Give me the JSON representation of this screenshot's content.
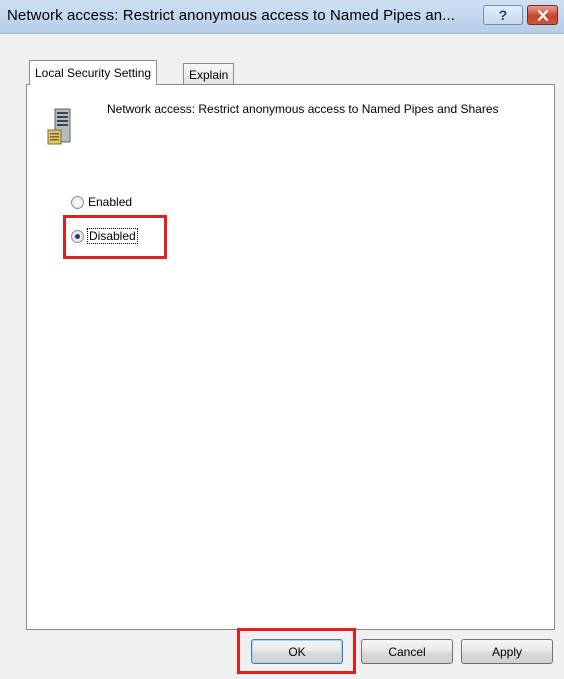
{
  "window": {
    "title": "Network access: Restrict anonymous access to Named Pipes an...",
    "help_glyph": "?"
  },
  "tabs": [
    {
      "label": "Local Security Setting",
      "active": true
    },
    {
      "label": "Explain",
      "active": false
    }
  ],
  "policy": {
    "icon": "server-icon",
    "description": "Network access: Restrict anonymous access to Named Pipes and Shares"
  },
  "options": [
    {
      "label": "Enabled",
      "selected": false
    },
    {
      "label": "Disabled",
      "selected": true
    }
  ],
  "buttons": {
    "ok": "OK",
    "cancel": "Cancel",
    "apply": "Apply"
  },
  "colors": {
    "highlight": "#e0201f",
    "close_button": "#c9442a"
  }
}
